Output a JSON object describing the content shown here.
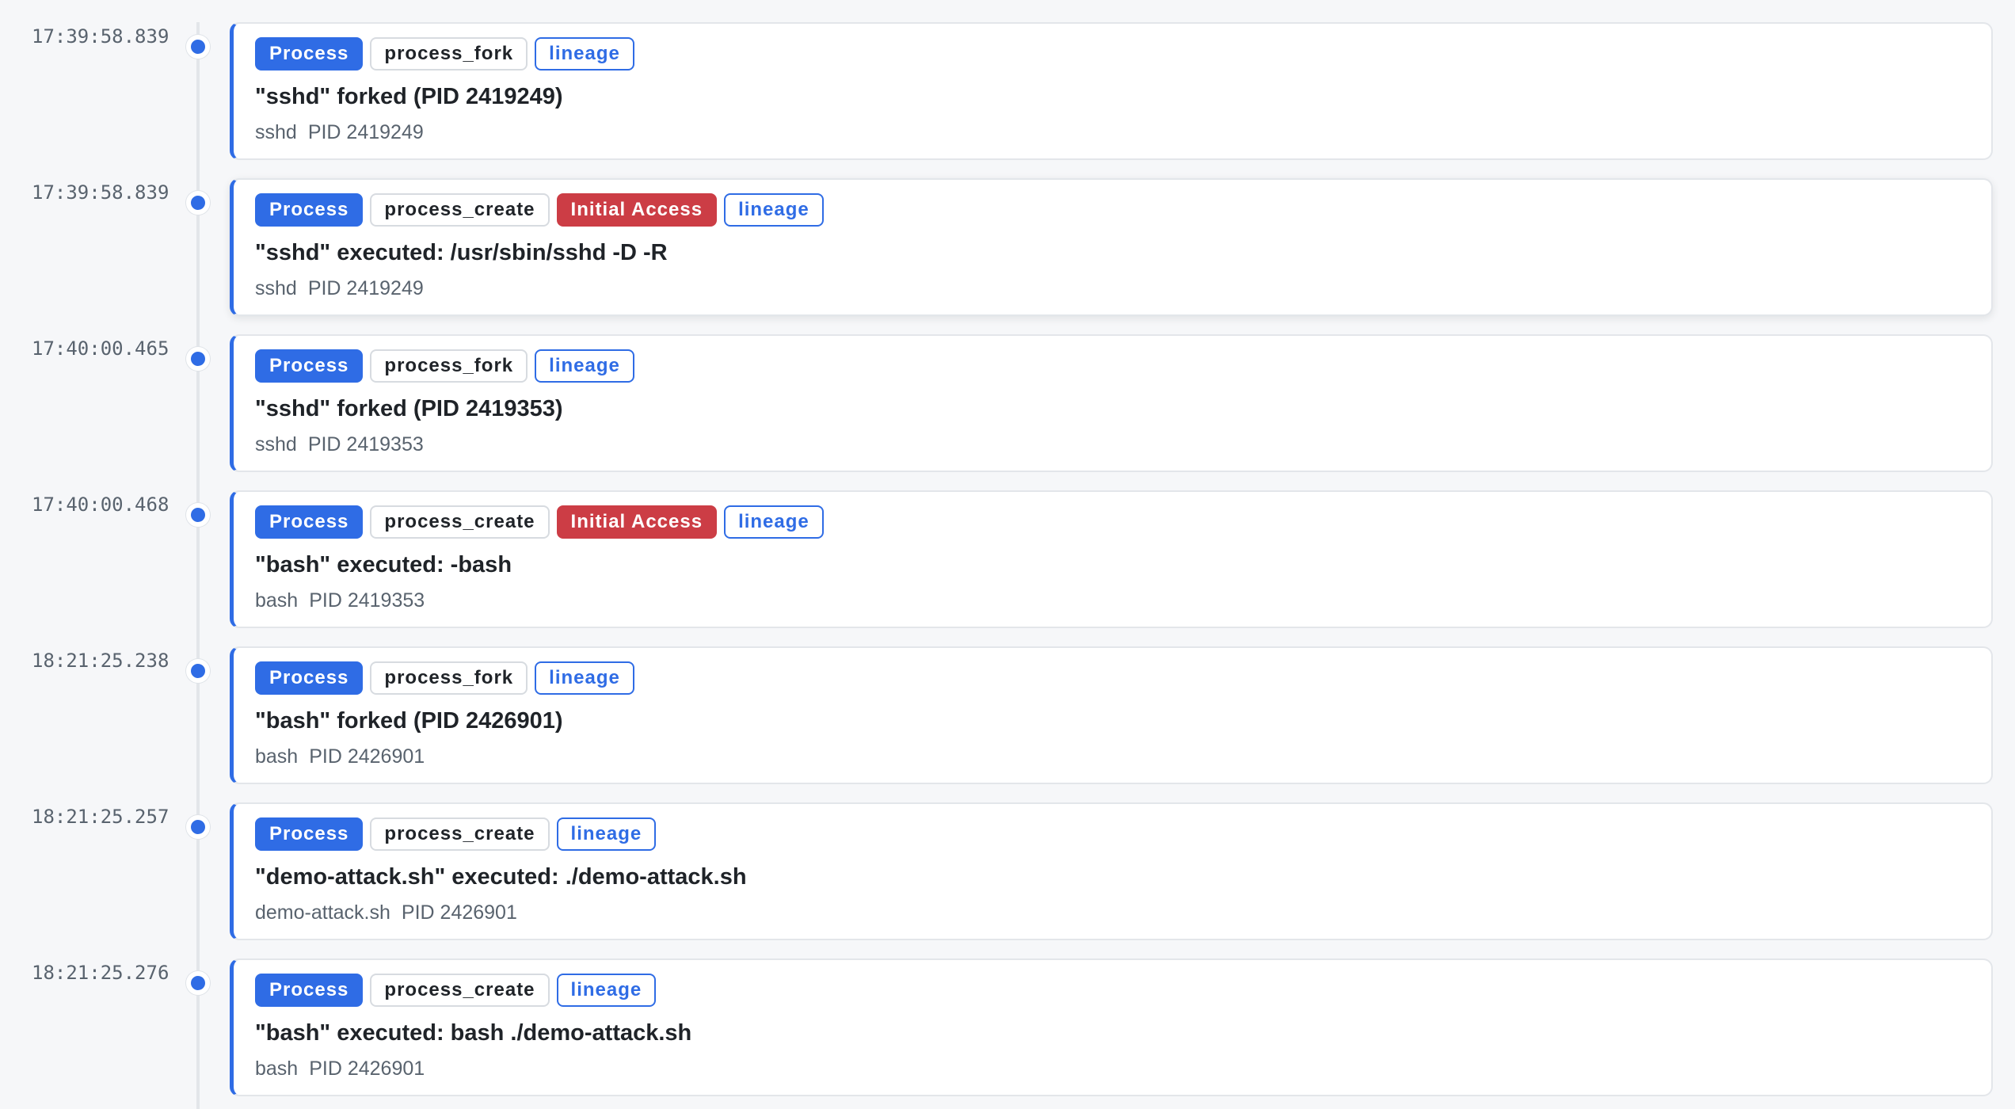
{
  "events": [
    {
      "time": "17:39:58.839",
      "category": "Process",
      "event_type": "process_fork",
      "tactic": null,
      "lineage": "lineage",
      "summary": "\"sshd\" forked (PID 2419249)",
      "process": "sshd",
      "pid": "PID 2419249"
    },
    {
      "time": "17:39:58.839",
      "category": "Process",
      "event_type": "process_create",
      "tactic": "Initial Access",
      "lineage": "lineage",
      "summary": "\"sshd\" executed: /usr/sbin/sshd -D -R",
      "process": "sshd",
      "pid": "PID 2419249"
    },
    {
      "time": "17:40:00.465",
      "category": "Process",
      "event_type": "process_fork",
      "tactic": null,
      "lineage": "lineage",
      "summary": "\"sshd\" forked (PID 2419353)",
      "process": "sshd",
      "pid": "PID 2419353"
    },
    {
      "time": "17:40:00.468",
      "category": "Process",
      "event_type": "process_create",
      "tactic": "Initial Access",
      "lineage": "lineage",
      "summary": "\"bash\" executed: -bash",
      "process": "bash",
      "pid": "PID 2419353"
    },
    {
      "time": "18:21:25.238",
      "category": "Process",
      "event_type": "process_fork",
      "tactic": null,
      "lineage": "lineage",
      "summary": "\"bash\" forked (PID 2426901)",
      "process": "bash",
      "pid": "PID 2426901"
    },
    {
      "time": "18:21:25.257",
      "category": "Process",
      "event_type": "process_create",
      "tactic": null,
      "lineage": "lineage",
      "summary": "\"demo-attack.sh\" executed: ./demo-attack.sh",
      "process": "demo-attack.sh",
      "pid": "PID 2426901"
    },
    {
      "time": "18:21:25.276",
      "category": "Process",
      "event_type": "process_create",
      "tactic": null,
      "lineage": "lineage",
      "summary": "\"bash\" executed: bash ./demo-attack.sh",
      "process": "bash",
      "pid": "PID 2426901"
    }
  ],
  "colors": {
    "accent": "#2f6ce5",
    "tactic": "#cc3d45",
    "card_border": "#e3e6ea",
    "muted_text": "#59636e"
  }
}
